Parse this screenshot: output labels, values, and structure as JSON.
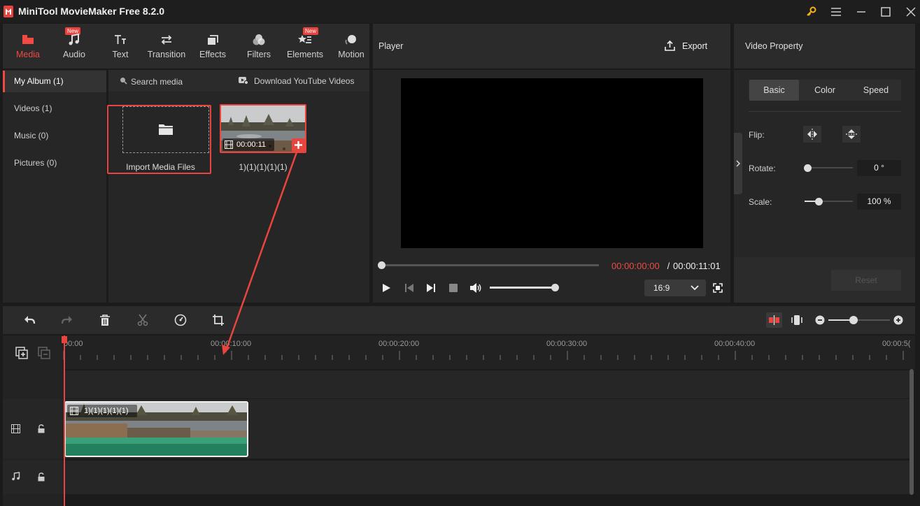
{
  "window": {
    "title": "MiniTool MovieMaker Free 8.2.0"
  },
  "toolbar": {
    "items": [
      {
        "label": "Media",
        "icon": "media-icon",
        "active": true
      },
      {
        "label": "Audio",
        "icon": "music-note-icon",
        "badge": "New"
      },
      {
        "label": "Text",
        "icon": "text-icon"
      },
      {
        "label": "Transition",
        "icon": "transition-arrows-icon"
      },
      {
        "label": "Effects",
        "icon": "effects-icon"
      },
      {
        "label": "Filters",
        "icon": "filters-icon"
      },
      {
        "label": "Elements",
        "icon": "elements-icon",
        "badge": "New"
      },
      {
        "label": "Motion",
        "icon": "motion-icon"
      }
    ]
  },
  "album": {
    "items": [
      {
        "label": "My Album (1)",
        "active": true
      },
      {
        "label": "Videos (1)"
      },
      {
        "label": "Music (0)"
      },
      {
        "label": "Pictures (0)"
      }
    ]
  },
  "media": {
    "search_label": "Search media",
    "download_label": "Download YouTube Videos",
    "import_label": "Import Media Files",
    "clip": {
      "name": "1)(1)(1)(1)(1)",
      "duration": "00:00:11"
    }
  },
  "player": {
    "title": "Player",
    "export_label": "Export",
    "current_time": "00:00:00:00",
    "separator": " / ",
    "total_time": "00:00:11:01",
    "aspect": "16:9",
    "progress": 0,
    "volume": 1.0
  },
  "property": {
    "title": "Video Property",
    "tabs": [
      "Basic",
      "Color",
      "Speed"
    ],
    "active_tab": "Basic",
    "flip_label": "Flip:",
    "rotate_label": "Rotate:",
    "rotate_value": "0 °",
    "scale_label": "Scale:",
    "scale_value": "100 %",
    "reset_label": "Reset"
  },
  "timeline": {
    "time_labels": [
      "00:00",
      "00:00:10:00",
      "00:00:20:00",
      "00:00:30:00",
      "00:00:40:00",
      "00:00:5("
    ],
    "clip_name": "1)(1)(1)(1)(1)",
    "zoom": 0.55
  },
  "colors": {
    "accent": "#ef4a44",
    "bg": "#1b1b1b",
    "panel": "#262626",
    "clip_green": "#23805f"
  }
}
